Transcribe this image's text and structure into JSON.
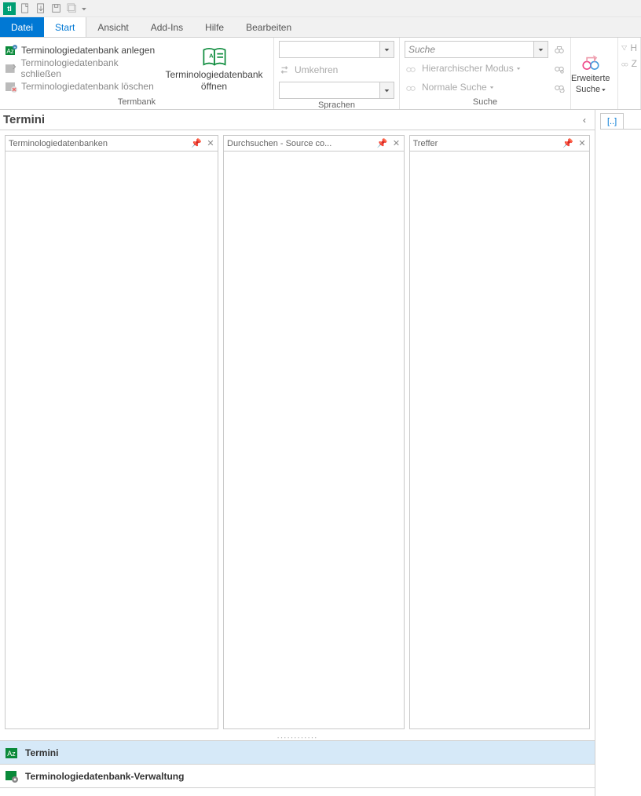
{
  "qat": {
    "app_abbrev": "tl"
  },
  "tabs": {
    "file": "Datei",
    "items": [
      "Start",
      "Ansicht",
      "Add-Ins",
      "Hilfe",
      "Bearbeiten"
    ],
    "active": "Start"
  },
  "ribbon": {
    "termbank": {
      "create": "Terminologiedatenbank anlegen",
      "close": "Terminologiedatenbank schließen",
      "delete": "Terminologiedatenbank löschen",
      "open_l1": "Terminologiedatenbank",
      "open_l2": "öffnen",
      "group_label": "Termbank"
    },
    "languages": {
      "invert": "Umkehren",
      "group_label": "Sprachen"
    },
    "search": {
      "placeholder": "Suche",
      "hier": "Hierarchischer Modus",
      "normal": "Normale Suche",
      "group_label": "Suche"
    },
    "advanced": {
      "label_l1": "Erweiterte",
      "label_l2": "Suche"
    },
    "filter": {
      "r1": "H",
      "r2": "Z"
    }
  },
  "workspace": {
    "section_title": "Termini",
    "panes": {
      "p1": "Terminologiedatenbanken",
      "p2": "Durchsuchen - Source co...",
      "p3": "Treffer"
    },
    "nav": {
      "termini": "Termini",
      "verwaltung": "Terminologiedatenbank-Verwaltung"
    }
  },
  "editor": {
    "tab_label": "[..]"
  }
}
